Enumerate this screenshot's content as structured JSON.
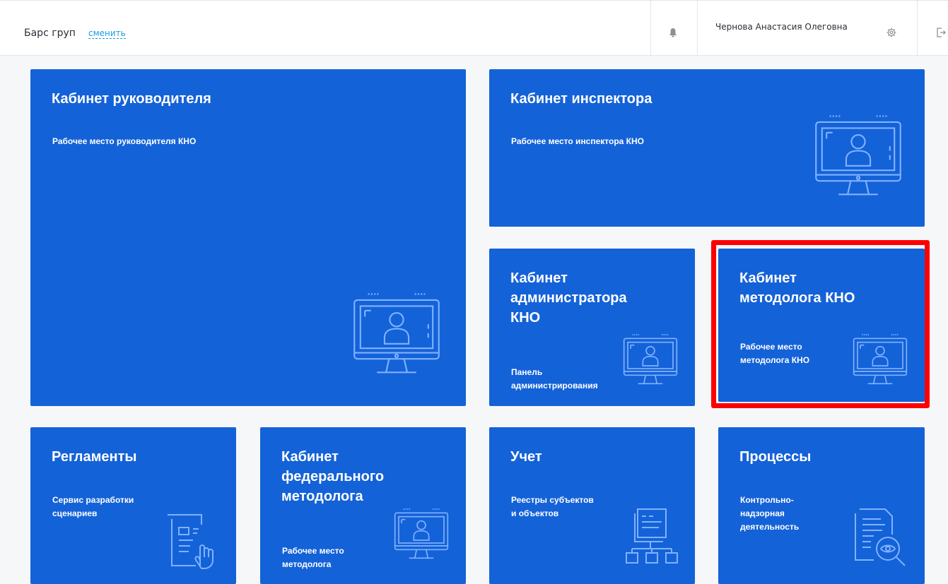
{
  "header": {
    "org_name": "Барс груп",
    "change_label": "сменить",
    "user_name": "Чернова Анастасия Олеговна",
    "icons": [
      "bell-icon",
      "gear-icon",
      "logout-icon"
    ]
  },
  "tiles": {
    "head": {
      "title": "Кабинет руководителя",
      "subtitle": "Рабочее место руководителя КНО",
      "icon": "monitor-user-icon"
    },
    "inspector": {
      "title": "Кабинет инспектора",
      "subtitle": "Рабочее место инспектора КНО",
      "icon": "monitor-user-icon"
    },
    "admin": {
      "title_lines": [
        "Кабинет",
        "администратора",
        "КНО"
      ],
      "subtitle_lines": [
        "Панель",
        "администрирования"
      ],
      "icon": "monitor-user-icon"
    },
    "methodologist": {
      "title_lines": [
        "Кабинет",
        "методолога КНО"
      ],
      "subtitle_lines": [
        "Рабочее место",
        "методолога КНО"
      ],
      "icon": "monitor-user-icon",
      "highlighted": true
    },
    "regulations": {
      "title": "Регламенты",
      "subtitle_lines": [
        "Сервис разработки",
        "сценариев"
      ],
      "icon": "document-hand-icon"
    },
    "federal": {
      "title_lines": [
        "Кабинет",
        "федерального",
        "методолога"
      ],
      "subtitle_lines": [
        "Рабочее место",
        "методолога"
      ],
      "icon": "monitor-user-icon"
    },
    "accounting": {
      "title": "Учет",
      "subtitle_lines": [
        "Реестры субъектов",
        "и объектов"
      ],
      "icon": "registry-tree-icon"
    },
    "processes": {
      "title": "Процессы",
      "subtitle_lines": [
        "Контрольно-",
        "надзорная",
        "деятельность"
      ],
      "icon": "document-eye-icon"
    }
  },
  "colors": {
    "tile": "#1462d8",
    "highlight": "#ff0000",
    "link": "#1a9ae0"
  }
}
